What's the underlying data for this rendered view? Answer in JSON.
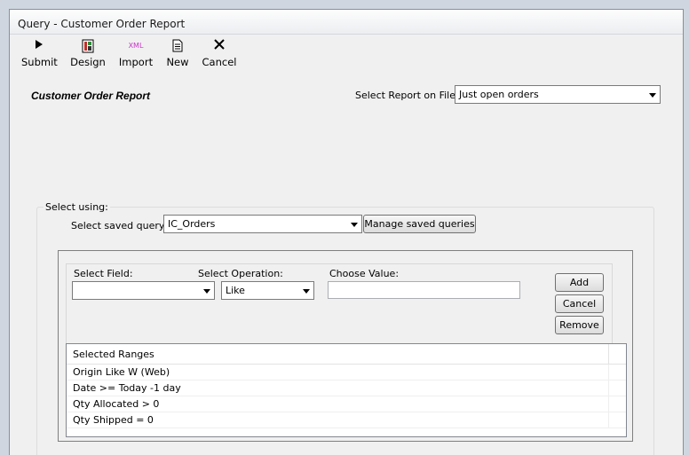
{
  "window": {
    "title": "Query - Customer Order Report"
  },
  "toolbar": {
    "submit": {
      "label": "Submit",
      "icon": "play-icon"
    },
    "design": {
      "label": "Design",
      "icon": "design-icon"
    },
    "import": {
      "label": "Import",
      "icon": "xml-icon",
      "icon_text": "XML"
    },
    "new": {
      "label": "New",
      "icon": "document-icon"
    },
    "cancel": {
      "label": "Cancel",
      "icon": "close-icon"
    }
  },
  "report": {
    "title": "Customer Order Report",
    "select_report_label": "Select Report on File:",
    "select_report_value": "Just open orders"
  },
  "select_using": {
    "legend": "Select using:",
    "saved_query_label": "Select saved query:",
    "saved_query_value": "IC_Orders",
    "manage_button": "Manage saved queries"
  },
  "filter": {
    "field_label": "Select Field:",
    "field_value": "",
    "operation_label": "Select Operation:",
    "operation_value": "Like",
    "value_label": "Choose Value:",
    "value_value": "",
    "add_button": "Add",
    "cancel_button": "Cancel",
    "remove_button": "Remove"
  },
  "ranges": {
    "header": "Selected Ranges",
    "rows": [
      "Origin Like W (Web)",
      "Date >= Today -1 day",
      "Qty Allocated > 0",
      "Qty Shipped = 0"
    ]
  },
  "colors": {
    "window_bg": "#f0f0f0",
    "xml_icon": "#cc33cc",
    "design_icon_red": "#c0302a",
    "design_icon_green": "#2f8a3a"
  }
}
